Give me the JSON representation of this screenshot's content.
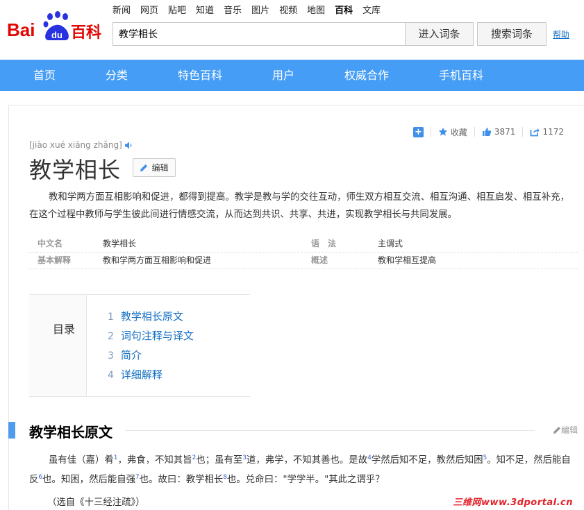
{
  "header": {
    "logo_text": "Baidu百科",
    "topnav": [
      "新闻",
      "网页",
      "贴吧",
      "知道",
      "音乐",
      "图片",
      "视频",
      "地图",
      "百科",
      "文库"
    ],
    "topnav_active": "百科",
    "search_value": "教学相长",
    "enter_button": "进入词条",
    "search_button": "搜索词条",
    "help_link": "帮助"
  },
  "mainnav": [
    "首页",
    "分类",
    "特色百科",
    "用户",
    "权威合作",
    "手机百科"
  ],
  "toolbar": {
    "collect_label": "收藏",
    "like_count": "3871",
    "share_count": "1172"
  },
  "entry": {
    "pinyin": "[jiào xué xiāng zhǎng]",
    "title": "教学相长",
    "edit_label": "编辑",
    "summary": "教和学两方面互相影响和促进，都得到提高。教学是教与学的交往互动，师生双方相互交流、相互沟通、相互启发、相互补充，在这个过程中教师与学生彼此间进行情感交流，从而达到共识、共享、共进，实现教学相长与共同发展。"
  },
  "basic_info": [
    {
      "k1": "中文名",
      "v1": "教学相长",
      "k2": "语　法",
      "v2": "主谓式"
    },
    {
      "k1": "基本解释",
      "v1": "教和学两方面互相影响和促进",
      "k2": "概述",
      "v2": "教和学相互提高"
    }
  ],
  "catalog": {
    "title": "目录",
    "items": [
      {
        "num": "1",
        "label": "教学相长原文"
      },
      {
        "num": "2",
        "label": "词句注释与译文"
      },
      {
        "num": "3",
        "label": "简介"
      },
      {
        "num": "4",
        "label": "详细解释"
      }
    ]
  },
  "section": {
    "title": "教学相长原文",
    "edit_label": "编辑",
    "para_parts": {
      "p1": "虽有佳（嘉）肴",
      "s1": "1",
      "p2": "，弗食，不知其旨",
      "s2": "2",
      "p3": "也；虽有至",
      "s3": "3",
      "p4": "道，弗学，不知其善也。是故",
      "s4": "4",
      "p5": "学然后知不足，教然后知困",
      "s5": "5",
      "p6": "。知不足，然后能自反",
      "s6": "6",
      "p7": "也。知困，然后能自强",
      "s7": "7",
      "p8": "也。故曰：教学相长",
      "s8": "8",
      "p9": "也。兑命曰：\"学学半。\"其此之谓乎？"
    },
    "source": "（选自《十三经注疏》）"
  },
  "watermark": "三维网www.3dportal.cn",
  "colors": {
    "nav_blue": "#459df5",
    "link_blue": "#136ec2",
    "baidu_red": "#e10602",
    "baidu_blue": "#2932e1"
  }
}
